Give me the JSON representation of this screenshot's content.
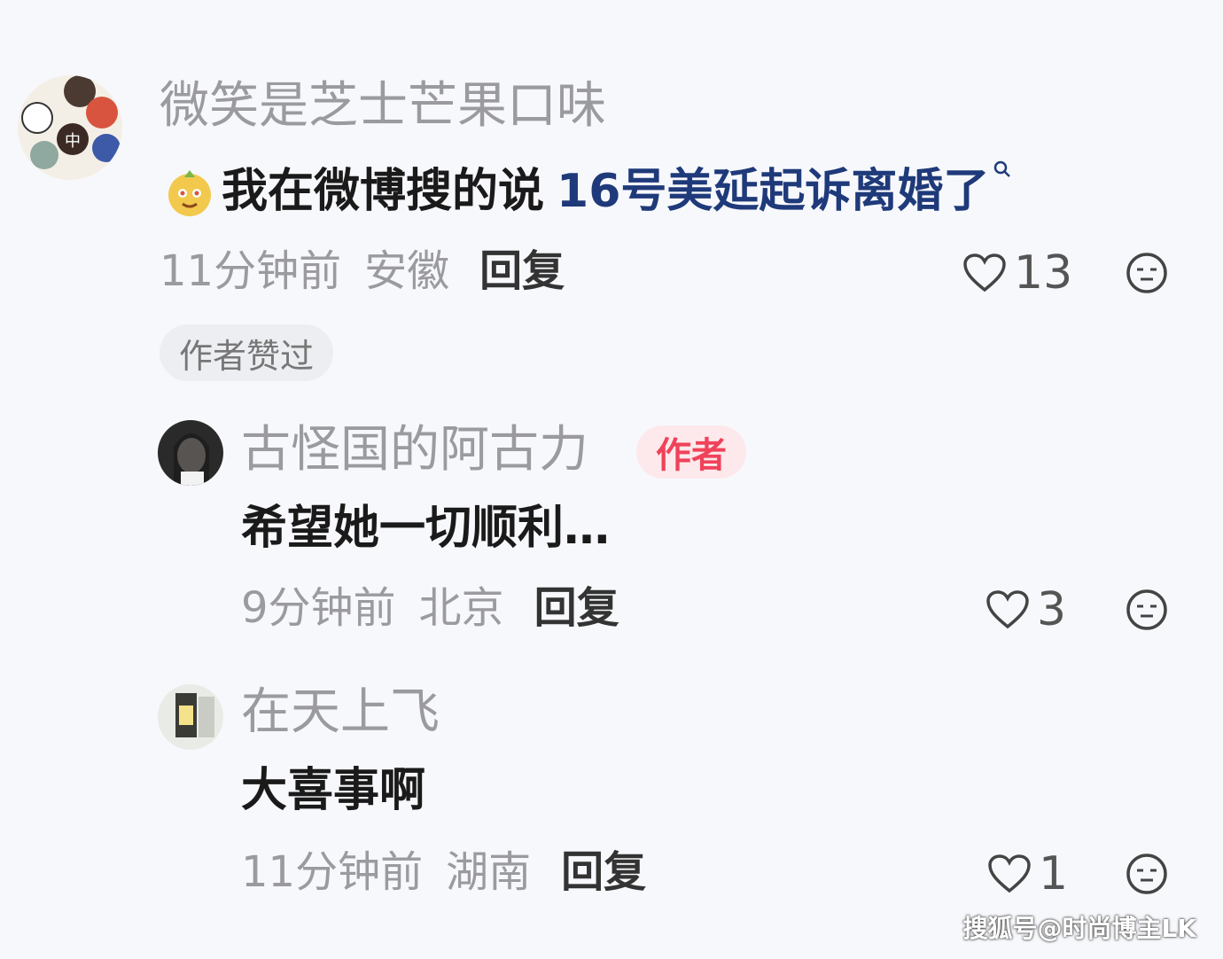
{
  "comments": [
    {
      "username": "微笑是芝士芒果口味",
      "text_prefix": "我在微博搜的说",
      "text_search_word": "16号美延起诉离婚了",
      "time": "11分钟前",
      "location": "安徽",
      "reply_label": "回复",
      "likes": "13",
      "tag": "作者赞过"
    },
    {
      "username": "古怪国的阿古力",
      "author_tag": "作者",
      "text": "希望她一切顺利…",
      "time": "9分钟前",
      "location": "北京",
      "reply_label": "回复",
      "likes": "3"
    },
    {
      "username": "在天上飞",
      "text": "大喜事啊",
      "time": "11分钟前",
      "location": "湖南",
      "reply_label": "回复",
      "likes": "1"
    }
  ],
  "watermark": "搜狐号@时尚博主LK",
  "colors": {
    "background": "#f7f8fb",
    "author_tag": "#f0425a",
    "search_word": "#1f3a7a"
  }
}
